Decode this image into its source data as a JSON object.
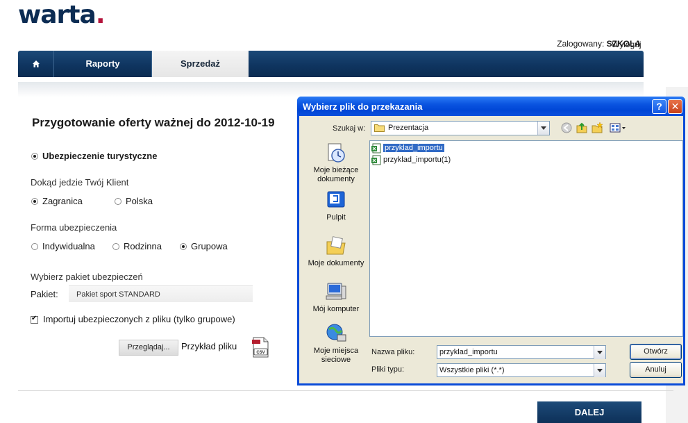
{
  "header": {
    "logo_text": "warta",
    "logo_dot": ".",
    "logged_in_label": "Zalogowany:",
    "username": "SZKOLA",
    "logout": "Wyloguj"
  },
  "nav": {
    "home_icon": "home-icon",
    "tabs": [
      {
        "label": "Raporty"
      },
      {
        "label": "Sprzedaż"
      }
    ]
  },
  "form": {
    "title": "Przygotowanie oferty ważnej do 2012-10-19",
    "insurance_type": "Ubezpieczenie turystyczne",
    "destination_label": "Dokąd jedzie Twój Klient",
    "destination_options": [
      "Zagranica",
      "Polska"
    ],
    "destination_selected": "Zagranica",
    "form_label": "Forma ubezpieczenia",
    "form_options": [
      "Indywidualna",
      "Rodzinna",
      "Grupowa"
    ],
    "form_selected": "Grupowa",
    "package_section_label": "Wybierz pakiet ubezpieczeń",
    "package_label": "Pakiet:",
    "package_value": "Pakiet sport STANDARD",
    "import_checkbox_label": "Importuj ubezpieczonych z pliku (tylko grupowe)",
    "import_checked": true,
    "browse_button": "Przeglądaj...",
    "sample_link": "Przykład pliku",
    "csv_icon_label": "CSV",
    "next_button": "DALEJ"
  },
  "dialog": {
    "title": "Wybierz plik do przekazania",
    "help_button": "?",
    "close_button": "✕",
    "look_in_label": "Szukaj w:",
    "look_in_value": "Prezentacja",
    "places": [
      {
        "label": "Moje bieżące dokumenty",
        "icon": "recent-documents-icon"
      },
      {
        "label": "Pulpit",
        "icon": "desktop-icon"
      },
      {
        "label": "Moje dokumenty",
        "icon": "my-documents-icon"
      },
      {
        "label": "Mój komputer",
        "icon": "my-computer-icon"
      },
      {
        "label": "Moje miejsca sieciowe",
        "icon": "network-places-icon"
      }
    ],
    "files": [
      {
        "name": "przyklad_importu",
        "selected": true
      },
      {
        "name": "przyklad_importu(1)",
        "selected": false
      }
    ],
    "file_name_label": "Nazwa pliku:",
    "file_name_value": "przyklad_importu",
    "file_type_label": "Pliki typu:",
    "file_type_value": "Wszystkie pliki (*.*)",
    "open_button": "Otwórz",
    "cancel_button": "Anuluj"
  }
}
